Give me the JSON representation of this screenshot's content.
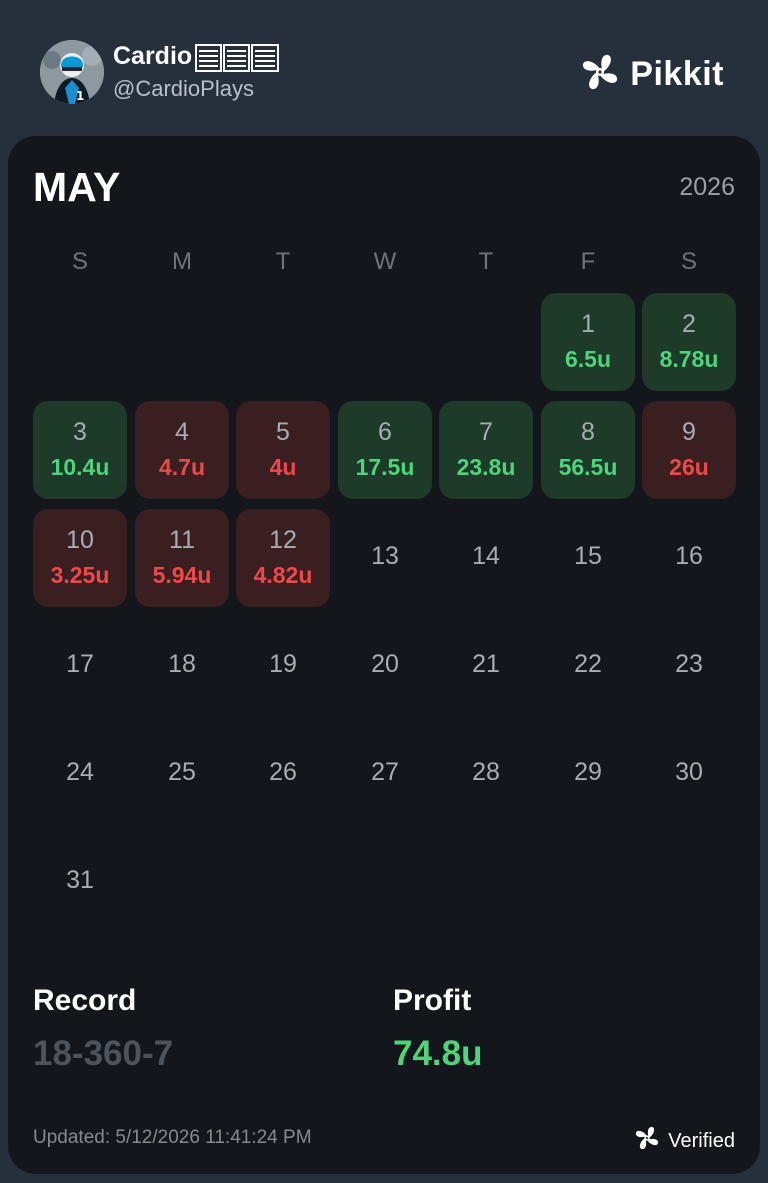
{
  "header": {
    "user_name": "Cardio",
    "handle": "@CardioPlays",
    "brand": "Pikkit",
    "icons": [
      "avatar",
      "bars-icon",
      "clover-logo-icon"
    ]
  },
  "calendar": {
    "month": "MAY",
    "year": "2026",
    "weekdays": [
      "S",
      "M",
      "T",
      "W",
      "T",
      "F",
      "S"
    ],
    "first_weekday_index": 5,
    "days": [
      {
        "day": "1",
        "amount": "6.5u",
        "result": "win"
      },
      {
        "day": "2",
        "amount": "8.78u",
        "result": "win"
      },
      {
        "day": "3",
        "amount": "10.4u",
        "result": "win"
      },
      {
        "day": "4",
        "amount": "4.7u",
        "result": "loss"
      },
      {
        "day": "5",
        "amount": "4u",
        "result": "loss"
      },
      {
        "day": "6",
        "amount": "17.5u",
        "result": "win"
      },
      {
        "day": "7",
        "amount": "23.8u",
        "result": "win"
      },
      {
        "day": "8",
        "amount": "56.5u",
        "result": "win"
      },
      {
        "day": "9",
        "amount": "26u",
        "result": "loss"
      },
      {
        "day": "10",
        "amount": "3.25u",
        "result": "loss"
      },
      {
        "day": "11",
        "amount": "5.94u",
        "result": "loss"
      },
      {
        "day": "12",
        "amount": "4.82u",
        "result": "loss"
      },
      {
        "day": "13"
      },
      {
        "day": "14"
      },
      {
        "day": "15"
      },
      {
        "day": "16"
      },
      {
        "day": "17"
      },
      {
        "day": "18"
      },
      {
        "day": "19"
      },
      {
        "day": "20"
      },
      {
        "day": "21"
      },
      {
        "day": "22"
      },
      {
        "day": "23"
      },
      {
        "day": "24"
      },
      {
        "day": "25"
      },
      {
        "day": "26"
      },
      {
        "day": "27"
      },
      {
        "day": "28"
      },
      {
        "day": "29"
      },
      {
        "day": "30"
      },
      {
        "day": "31"
      }
    ]
  },
  "stats": {
    "record_label": "Record",
    "record_value": "18-360-7",
    "profit_label": "Profit",
    "profit_value": "74.8u"
  },
  "footer": {
    "updated": "Updated: 5/12/2026 11:41:24 PM",
    "verified": "Verified"
  },
  "colors": {
    "page_bg": "#262f3c",
    "card_bg": "#13161b",
    "win_bg": "#1e3a29",
    "win_text": "#4dd57a",
    "loss_bg": "#3a1f20",
    "loss_text": "#f04848"
  }
}
